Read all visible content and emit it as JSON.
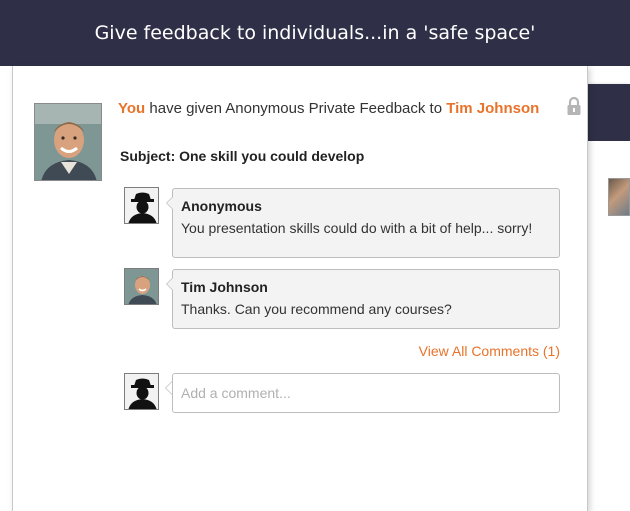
{
  "header": {
    "title": "Give feedback to individuals...in a 'safe space'"
  },
  "feedback": {
    "you_label": "You",
    "action_text": " have given Anonymous Private Feedback to ",
    "recipient": "Tim Johnson",
    "subject": "Subject: One skill you could develop"
  },
  "comments": [
    {
      "author": "Anonymous",
      "text": "You presentation skills could do with a bit of help... sorry!"
    },
    {
      "author": "Tim Johnson",
      "text": "Thanks. Can you recommend any courses?"
    }
  ],
  "view_all": "View All Comments (1)",
  "add_comment": {
    "placeholder": "Add a comment..."
  },
  "colors": {
    "header_bg": "#2f3047",
    "accent": "#e8732a",
    "bubble_bg": "#f3f3f3"
  },
  "icons": [
    "lock-icon",
    "anonymous-avatar",
    "user-avatar"
  ]
}
